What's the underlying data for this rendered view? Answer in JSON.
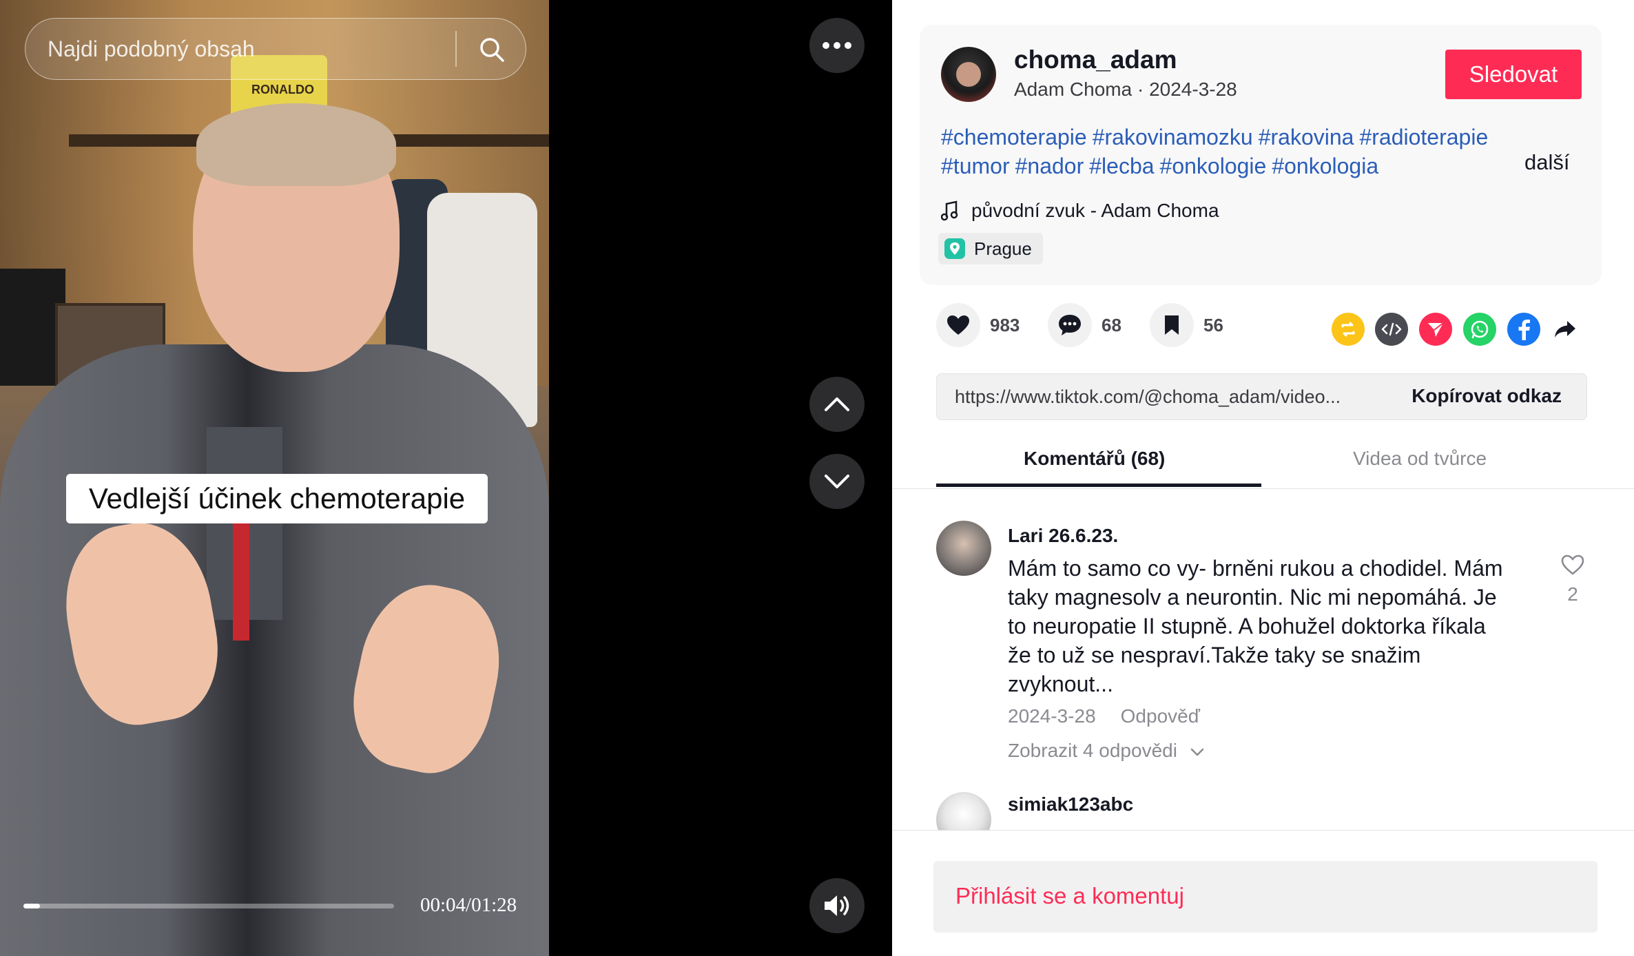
{
  "search": {
    "placeholder": "Najdi podobný obsah"
  },
  "video": {
    "caption": "Vedlejší účinek chemoterapie",
    "time": "00:04/01:28",
    "progress_fraction": 0.045
  },
  "post": {
    "username": "choma_adam",
    "display_name": "Adam Choma",
    "date": "2024-3-28",
    "subline_separator": " · ",
    "follow_label": "Sledovat",
    "hashtags": [
      "#chemoterapie",
      "#rakovinamozku",
      "#rakovina",
      "#radioterapie",
      "#tumor",
      "#nador",
      "#lecba",
      "#onkologie",
      "#onkologia"
    ],
    "more_label": "další",
    "music": "původní zvuk - Adam Choma",
    "location": "Prague"
  },
  "actions": {
    "likes": "983",
    "comments": "68",
    "saves": "56"
  },
  "share": {
    "icons": [
      "repost-icon",
      "embed-icon",
      "send-icon",
      "whatsapp-icon",
      "facebook-icon",
      "share-arrow-icon"
    ],
    "colors": {
      "repost": "#fcc419",
      "embed": "#4a4b52",
      "send": "#fe2c55",
      "whatsapp": "#25d366",
      "facebook": "#1877f2"
    }
  },
  "link": {
    "url": "https://www.tiktok.com/@choma_adam/video...",
    "copy_label": "Kopírovat odkaz"
  },
  "tabs": [
    {
      "label": "Komentářů (68)"
    },
    {
      "label": "Videa od tvůrce"
    }
  ],
  "comments": [
    {
      "author": "Lari 26.6.23.",
      "lines": [
        "Mám to samo co vy- brněni rukou a chodidel. Mám",
        "taky magnesolv a neurontin. Nic mi nepomáhá. Je",
        "to neuropatie II stupně. A bohužel doktorka říkala",
        "že to už se nespraví.Takže taky se snažim",
        "zvyknout..."
      ],
      "date": "2024-3-28",
      "reply_label": "Odpověď",
      "likes": "2",
      "view_replies": "Zobrazit 4 odpovědi"
    },
    {
      "author": "simiak123abc"
    }
  ],
  "login": {
    "label": "Přihlásit se a komentuj"
  },
  "colors": {
    "accent": "#fe2c55",
    "hashtag": "#2b5db8",
    "location_icon": "#22c3a5"
  }
}
